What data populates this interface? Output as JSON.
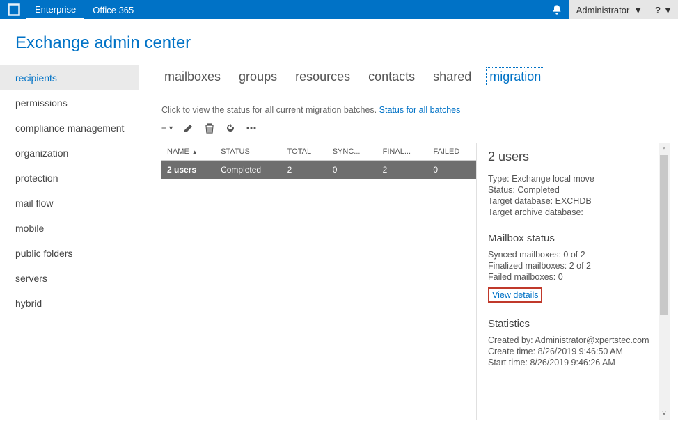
{
  "topbar": {
    "nav": {
      "enterprise": "Enterprise",
      "office365": "Office 365"
    },
    "user": "Administrator",
    "help": "?"
  },
  "page_title": "Exchange admin center",
  "sidebar": {
    "items": [
      {
        "label": "recipients"
      },
      {
        "label": "permissions"
      },
      {
        "label": "compliance management"
      },
      {
        "label": "organization"
      },
      {
        "label": "protection"
      },
      {
        "label": "mail flow"
      },
      {
        "label": "mobile"
      },
      {
        "label": "public folders"
      },
      {
        "label": "servers"
      },
      {
        "label": "hybrid"
      }
    ]
  },
  "tabs": {
    "mailboxes": "mailboxes",
    "groups": "groups",
    "resources": "resources",
    "contacts": "contacts",
    "shared": "shared",
    "migration": "migration"
  },
  "hint": {
    "text": "Click to view the status for all current migration batches.",
    "link": "Status for all batches"
  },
  "table": {
    "headers": {
      "name": "NAME",
      "status": "STATUS",
      "total": "TOTAL",
      "synced": "SYNC...",
      "finalized": "FINAL...",
      "failed": "FAILED"
    },
    "rows": [
      {
        "name": "2 users",
        "status": "Completed",
        "total": "2",
        "synced": "0",
        "finalized": "2",
        "failed": "0"
      }
    ]
  },
  "details": {
    "title": "2 users",
    "type_label": "Type",
    "type_value": "Exchange local move",
    "status_label": "Status",
    "status_value": "Completed",
    "targetdb_label": "Target database",
    "targetdb_value": "EXCHDB",
    "targetarchive_label": "Target archive database",
    "targetarchive_value": "",
    "mailbox_status_title": "Mailbox status",
    "synced_label": "Synced mailboxes",
    "synced_value": "0 of 2",
    "finalized_label": "Finalized mailboxes",
    "finalized_value": "2 of 2",
    "failed_label": "Failed mailboxes",
    "failed_value": "0",
    "view_details": "View details",
    "statistics_title": "Statistics",
    "created_by_label": "Created by",
    "created_by_value": "Administrator@xpertstec.com",
    "create_time_label": "Create time",
    "create_time_value": "8/26/2019 9:46:50 AM",
    "start_time_label": "Start time",
    "start_time_value": "8/26/2019 9:46:26 AM"
  }
}
